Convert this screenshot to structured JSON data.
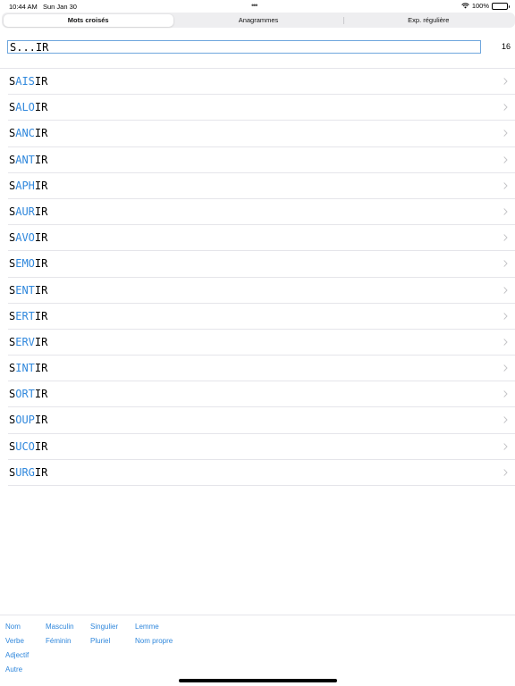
{
  "status_bar": {
    "time": "10:44 AM",
    "date": "Sun Jan 30",
    "dots": "•••",
    "battery": "100%"
  },
  "tabs": [
    {
      "label": "Mots croisés",
      "selected": true
    },
    {
      "label": "Anagrammes",
      "selected": false
    },
    {
      "label": "Exp. régulière",
      "selected": false
    }
  ],
  "search": {
    "value": "S...IR",
    "count": "16"
  },
  "results": [
    {
      "first": "S",
      "middle": "AIS",
      "last": "IR"
    },
    {
      "first": "S",
      "middle": "ALO",
      "last": "IR"
    },
    {
      "first": "S",
      "middle": "ANC",
      "last": "IR"
    },
    {
      "first": "S",
      "middle": "ANT",
      "last": "IR"
    },
    {
      "first": "S",
      "middle": "APH",
      "last": "IR"
    },
    {
      "first": "S",
      "middle": "AUR",
      "last": "IR"
    },
    {
      "first": "S",
      "middle": "AVO",
      "last": "IR"
    },
    {
      "first": "S",
      "middle": "EMO",
      "last": "IR"
    },
    {
      "first": "S",
      "middle": "ENT",
      "last": "IR"
    },
    {
      "first": "S",
      "middle": "ERT",
      "last": "IR"
    },
    {
      "first": "S",
      "middle": "ERV",
      "last": "IR"
    },
    {
      "first": "S",
      "middle": "INT",
      "last": "IR"
    },
    {
      "first": "S",
      "middle": "ORT",
      "last": "IR"
    },
    {
      "first": "S",
      "middle": "OUP",
      "last": "IR"
    },
    {
      "first": "S",
      "middle": "UCO",
      "last": "IR"
    },
    {
      "first": "S",
      "middle": "URG",
      "last": "IR"
    }
  ],
  "filters": {
    "nom": "Nom",
    "verbe": "Verbe",
    "adjectif": "Adjectif",
    "autre": "Autre",
    "masculin": "Masculin",
    "feminin": "Féminin",
    "singulier": "Singulier",
    "pluriel": "Pluriel",
    "lemme": "Lemme",
    "nom_propre": "Nom propre"
  },
  "colors": {
    "accent": "#2f87dc",
    "separator": "#e5e5ea",
    "chevron": "#c4c4c7"
  }
}
